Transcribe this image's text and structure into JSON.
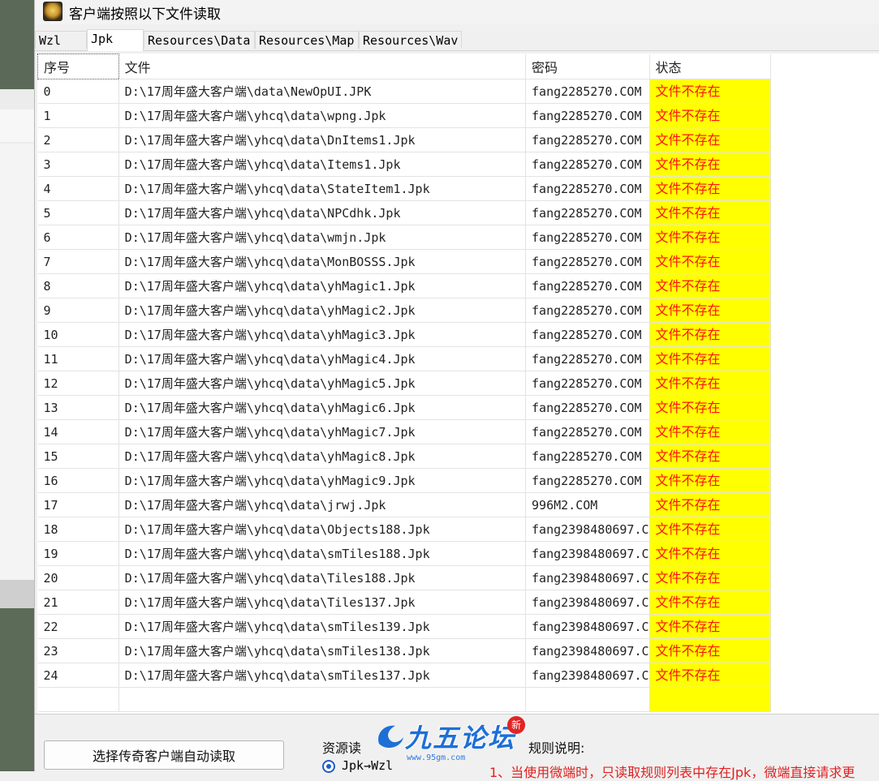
{
  "window": {
    "title": "客户端按照以下文件读取"
  },
  "tabs": [
    {
      "label": "Wzl"
    },
    {
      "label": "Jpk"
    },
    {
      "label": "Resources\\Data"
    },
    {
      "label": "Resources\\Map"
    },
    {
      "label": "Resources\\Wav"
    }
  ],
  "active_tab": "Jpk",
  "colors": {
    "status_bg": "#ffff00",
    "status_text": "#ff1010",
    "tab_active_bg": "#ffffff"
  },
  "grid": {
    "headers": {
      "index": "序号",
      "file": "文件",
      "password": "密码",
      "status": "状态"
    },
    "rows": [
      {
        "index": "0",
        "file": "D:\\17周年盛大客户端\\data\\NewOpUI.JPK",
        "password": "fang2285270.COM",
        "status": "文件不存在"
      },
      {
        "index": "1",
        "file": "D:\\17周年盛大客户端\\yhcq\\data\\wpng.Jpk",
        "password": "fang2285270.COM",
        "status": "文件不存在"
      },
      {
        "index": "2",
        "file": "D:\\17周年盛大客户端\\yhcq\\data\\DnItems1.Jpk",
        "password": "fang2285270.COM",
        "status": "文件不存在"
      },
      {
        "index": "3",
        "file": "D:\\17周年盛大客户端\\yhcq\\data\\Items1.Jpk",
        "password": "fang2285270.COM",
        "status": "文件不存在"
      },
      {
        "index": "4",
        "file": "D:\\17周年盛大客户端\\yhcq\\data\\StateItem1.Jpk",
        "password": "fang2285270.COM",
        "status": "文件不存在"
      },
      {
        "index": "5",
        "file": "D:\\17周年盛大客户端\\yhcq\\data\\NPCdhk.Jpk",
        "password": "fang2285270.COM",
        "status": "文件不存在"
      },
      {
        "index": "6",
        "file": "D:\\17周年盛大客户端\\yhcq\\data\\wmjn.Jpk",
        "password": "fang2285270.COM",
        "status": "文件不存在"
      },
      {
        "index": "7",
        "file": "D:\\17周年盛大客户端\\yhcq\\data\\MonBOSSS.Jpk",
        "password": "fang2285270.COM",
        "status": "文件不存在"
      },
      {
        "index": "8",
        "file": "D:\\17周年盛大客户端\\yhcq\\data\\yhMagic1.Jpk",
        "password": "fang2285270.COM",
        "status": "文件不存在"
      },
      {
        "index": "9",
        "file": "D:\\17周年盛大客户端\\yhcq\\data\\yhMagic2.Jpk",
        "password": "fang2285270.COM",
        "status": "文件不存在"
      },
      {
        "index": "10",
        "file": "D:\\17周年盛大客户端\\yhcq\\data\\yhMagic3.Jpk",
        "password": "fang2285270.COM",
        "status": "文件不存在"
      },
      {
        "index": "11",
        "file": "D:\\17周年盛大客户端\\yhcq\\data\\yhMagic4.Jpk",
        "password": "fang2285270.COM",
        "status": "文件不存在"
      },
      {
        "index": "12",
        "file": "D:\\17周年盛大客户端\\yhcq\\data\\yhMagic5.Jpk",
        "password": "fang2285270.COM",
        "status": "文件不存在"
      },
      {
        "index": "13",
        "file": "D:\\17周年盛大客户端\\yhcq\\data\\yhMagic6.Jpk",
        "password": "fang2285270.COM",
        "status": "文件不存在"
      },
      {
        "index": "14",
        "file": "D:\\17周年盛大客户端\\yhcq\\data\\yhMagic7.Jpk",
        "password": "fang2285270.COM",
        "status": "文件不存在"
      },
      {
        "index": "15",
        "file": "D:\\17周年盛大客户端\\yhcq\\data\\yhMagic8.Jpk",
        "password": "fang2285270.COM",
        "status": "文件不存在"
      },
      {
        "index": "16",
        "file": "D:\\17周年盛大客户端\\yhcq\\data\\yhMagic9.Jpk",
        "password": "fang2285270.COM",
        "status": "文件不存在"
      },
      {
        "index": "17",
        "file": "D:\\17周年盛大客户端\\yhcq\\data\\jrwj.Jpk",
        "password": "996M2.COM",
        "status": "文件不存在"
      },
      {
        "index": "18",
        "file": "D:\\17周年盛大客户端\\yhcq\\data\\Objects188.Jpk",
        "password": "fang2398480697.C",
        "status": "文件不存在"
      },
      {
        "index": "19",
        "file": "D:\\17周年盛大客户端\\yhcq\\data\\smTiles188.Jpk",
        "password": "fang2398480697.C",
        "status": "文件不存在"
      },
      {
        "index": "20",
        "file": "D:\\17周年盛大客户端\\yhcq\\data\\Tiles188.Jpk",
        "password": "fang2398480697.C",
        "status": "文件不存在"
      },
      {
        "index": "21",
        "file": "D:\\17周年盛大客户端\\yhcq\\data\\Tiles137.Jpk",
        "password": "fang2398480697.C",
        "status": "文件不存在"
      },
      {
        "index": "22",
        "file": "D:\\17周年盛大客户端\\yhcq\\data\\smTiles139.Jpk",
        "password": "fang2398480697.C",
        "status": "文件不存在"
      },
      {
        "index": "23",
        "file": "D:\\17周年盛大客户端\\yhcq\\data\\smTiles138.Jpk",
        "password": "fang2398480697.C",
        "status": "文件不存在"
      },
      {
        "index": "24",
        "file": "D:\\17周年盛大客户端\\yhcq\\data\\smTiles137.Jpk",
        "password": "fang2398480697.C",
        "status": "文件不存在"
      }
    ]
  },
  "bottom": {
    "auto_read_button": "选择传奇客户端自动读取",
    "resource_group_label": "资源读",
    "radio_option": "Jpk→Wzl",
    "rules_label": "规则说明:",
    "rules_text": "1、当使用微端时，只读取规则列表中存在Jpk，微端直接请求更"
  },
  "watermark": {
    "name": "九五论坛",
    "url": "www.95gm.com",
    "badge": "新"
  }
}
